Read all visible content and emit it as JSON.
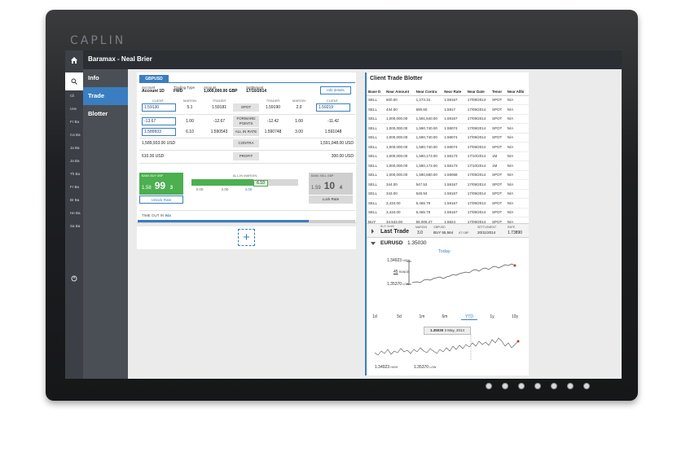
{
  "bezel": {
    "brand": "CAPLIN"
  },
  "topbar": {
    "title": "Baramax - Neal Brier"
  },
  "rail": {
    "items": [
      "Cli",
      "Use",
      "Fr Ba",
      "Ca Ba",
      "Ja Ba",
      "Ja Ba",
      "Th Ba",
      "Fr Ba",
      "Br Ba",
      "He Ba",
      "Sa Ba"
    ]
  },
  "menu": {
    "items": [
      "Info",
      "Trade",
      "Blotter"
    ]
  },
  "tile": {
    "pair": "GBPUSD",
    "account_label": "Account",
    "account_value": "Account 1D",
    "trading_type_label": "Trading Type",
    "trading_type_value": "FWD",
    "amount_label": "Amount",
    "amount_value": "1,000,000.00 GBP",
    "settlement_label": "Settlement",
    "settlement_value": "17/10/2014",
    "edit_button": "edit details",
    "col_client": "CLIENT",
    "col_margin": "MARGIN",
    "col_trader": "TRADER",
    "row1": {
      "client": "1.59130",
      "margin": "5.1",
      "trader": "1.59181",
      "label": "SPOT",
      "trader_r": "1.59190",
      "margin_r": "2.0",
      "client_r": "1.59219"
    },
    "row2": {
      "client": "-13.67",
      "margin": "1.00",
      "trader": "-12.67",
      "label": "FORWARD POINTS",
      "trader_r": "-12.42",
      "margin_r": "1.00",
      "client_r": "-11.42"
    },
    "row3": {
      "client": "1.589933",
      "margin": "6.10",
      "trader": "1.590543",
      "label": "ALL IN RATE",
      "trader_r": "1.590748",
      "margin_r": "3.00",
      "client_r": "1.591048"
    },
    "contra_left": "1,589,933.00 USD",
    "contra_label": "CONTRA",
    "contra_right": "1,591,048.00 USD",
    "profit_left": "610.00 USD",
    "profit_label": "PROFIT",
    "profit_right": "300.00 USD",
    "buy_label": "BANK BUY GBP",
    "buy_small": "1.58",
    "buy_big": "99",
    "buy_pip": "3",
    "sell_label": "BANK SELL GBP",
    "sell_small": "1.59",
    "sell_big": "10",
    "sell_pip": "4",
    "all_in_margin_label": "ALL-IN MARGIN",
    "margin_value": "6.10",
    "scale_0": "0.00",
    "scale_1": "2.00",
    "scale_2": "4.00",
    "unlock_button": "Unlock Rate",
    "lock_button": "Lock Rate",
    "timeout_label": "TIME OUT IN",
    "timeout_value": "94s",
    "add_button": "+"
  },
  "blotter": {
    "title": "Client Trade Blotter",
    "columns": [
      "Base D",
      "Near Amount",
      "Near Contra",
      "Near Rate",
      "Near Date",
      "Tenor",
      "Near Allbi"
    ],
    "rows": [
      [
        "SELL",
        "600.00",
        "1,273.34",
        "1.59167",
        "17/09/2014",
        "SPOT",
        "N/A"
      ],
      [
        "SELL",
        "434.00",
        "690.60",
        "1.5917",
        "17/09/2014",
        "SPOT",
        "N/A"
      ],
      [
        "SELL",
        "1,000,000.00",
        "1,591,640.00",
        "1.59167",
        "17/09/2014",
        "SPOT",
        "N/A"
      ],
      [
        "SELL",
        "1,000,000.00",
        "1,590,740.00",
        "1.59074",
        "17/09/2014",
        "SPOT",
        "N/A"
      ],
      [
        "SELL",
        "1,000,000.00",
        "1,590,740.00",
        "1.59074",
        "17/09/2014",
        "SPOT",
        "N/A"
      ],
      [
        "SELL",
        "1,000,000.00",
        "1,590,740.00",
        "1.59074",
        "17/09/2014",
        "SPOT",
        "N/A"
      ],
      [
        "SELL",
        "1,000,000.00",
        "1,580,173.00",
        "1.58173",
        "17/10/2014",
        "1M",
        "N/A"
      ],
      [
        "SELL",
        "1,000,000.00",
        "1,580,173.00",
        "1.58173",
        "17/10/2014",
        "1M",
        "N/A"
      ],
      [
        "SELL",
        "1,000,000.00",
        "1,590,680.00",
        "1.59068",
        "17/09/2014",
        "SPOT",
        "N/A"
      ],
      [
        "SELL",
        "344.00",
        "547.53",
        "1.59167",
        "17/09/2014",
        "SPOT",
        "N/A"
      ],
      [
        "SELL",
        "343.00",
        "545.94",
        "1.59167",
        "17/09/2014",
        "SPOT",
        "N/A"
      ],
      [
        "SELL",
        "3,434.00",
        "5,465.79",
        "1.59167",
        "17/09/2014",
        "SPOT",
        "N/A"
      ],
      [
        "SELL",
        "3,434.00",
        "5,465.79",
        "1.59167",
        "17/09/2014",
        "SPOT",
        "N/A"
      ],
      [
        "BUY",
        "34,543.00",
        "55,006.27",
        "1.5924",
        "17/09/2014",
        "SPOT",
        "N/A"
      ],
      [
        "SELL",
        "987,987.00",
        "1,571,986.12",
        "1.59111",
        "17/09/2014",
        "SPOT",
        "N/A"
      ]
    ],
    "last_trade": {
      "meta": "BUY Smith",
      "label": "Last Trade",
      "margin_label": "MARGIN",
      "margin_value": "3.0",
      "pair_label": "GBPUSD",
      "buy_text": "BUY 55,564",
      "ccy": "AT GBP",
      "settlement_label": "SETTLEMENT",
      "settlement_value": "20/11/2014",
      "rate_label": "RATE",
      "rate_value": "1.73890"
    },
    "pair": "EURUSD",
    "price": "1.35030",
    "today_label": "Today",
    "high_value": "1.34923",
    "high_label": "HIGH",
    "range_value": "45",
    "range_label": "RANGE",
    "low_value": "1.35370",
    "low_label": "LOW",
    "periods": [
      "1d",
      "5d",
      "1m",
      "6m",
      "YTD",
      "1y",
      "10y"
    ],
    "tooltip_value": "1.35030",
    "tooltip_date": "3 May, 2014",
    "bottom_high_value": "1.34923",
    "bottom_high_label": "HIGH",
    "bottom_low_value": "1.35370",
    "bottom_low_label": "LOW"
  },
  "colors": {
    "accent": "#3a7ec1",
    "buy": "#4caf50",
    "sell": "#cfcfcf",
    "chart_end": "#c0392b"
  },
  "icons": [
    "home-icon",
    "search-icon",
    "power-icon",
    "chevron-right-icon",
    "chevron-down-icon",
    "plus-icon"
  ]
}
